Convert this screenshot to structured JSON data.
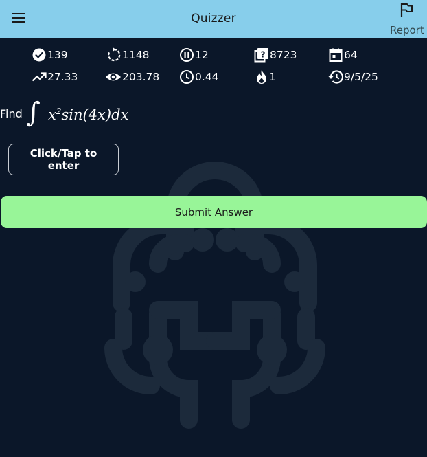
{
  "appbar": {
    "title": "Quizzer",
    "menu_icon": "menu-icon",
    "report": {
      "icon": "flag-icon",
      "label": "Report"
    }
  },
  "stats": {
    "row1": [
      {
        "icon": "check-circle-icon",
        "value": "139"
      },
      {
        "icon": "repeat-icon",
        "value": "1148"
      },
      {
        "icon": "pause-circle-icon",
        "value": "12"
      },
      {
        "icon": "question-box-icon",
        "value": "8723"
      },
      {
        "icon": "calendar-icon",
        "value": "64"
      }
    ],
    "row2": [
      {
        "icon": "trending-up-icon",
        "value": "27.33"
      },
      {
        "icon": "eye-icon",
        "value": "203.78"
      },
      {
        "icon": "clock-icon",
        "value": "0.44"
      },
      {
        "icon": "fire-icon",
        "value": "1"
      },
      {
        "icon": "history-icon",
        "value": "9/5/25"
      }
    ]
  },
  "question": {
    "prompt": "Find",
    "integral_symbol": "∫",
    "expr_base": "x",
    "expr_exponent": "2",
    "expr_rest": "sin(4x)dx"
  },
  "answer_button": {
    "label": "Click/Tap to enter"
  },
  "submit_button": {
    "label": "Submit Answer"
  },
  "colors": {
    "appbar": "#87ceeb",
    "background": "#0b1729",
    "submit": "#98f598",
    "watermark": "#1c2a3b"
  },
  "watermark_logo": "brain-logo-watermark"
}
